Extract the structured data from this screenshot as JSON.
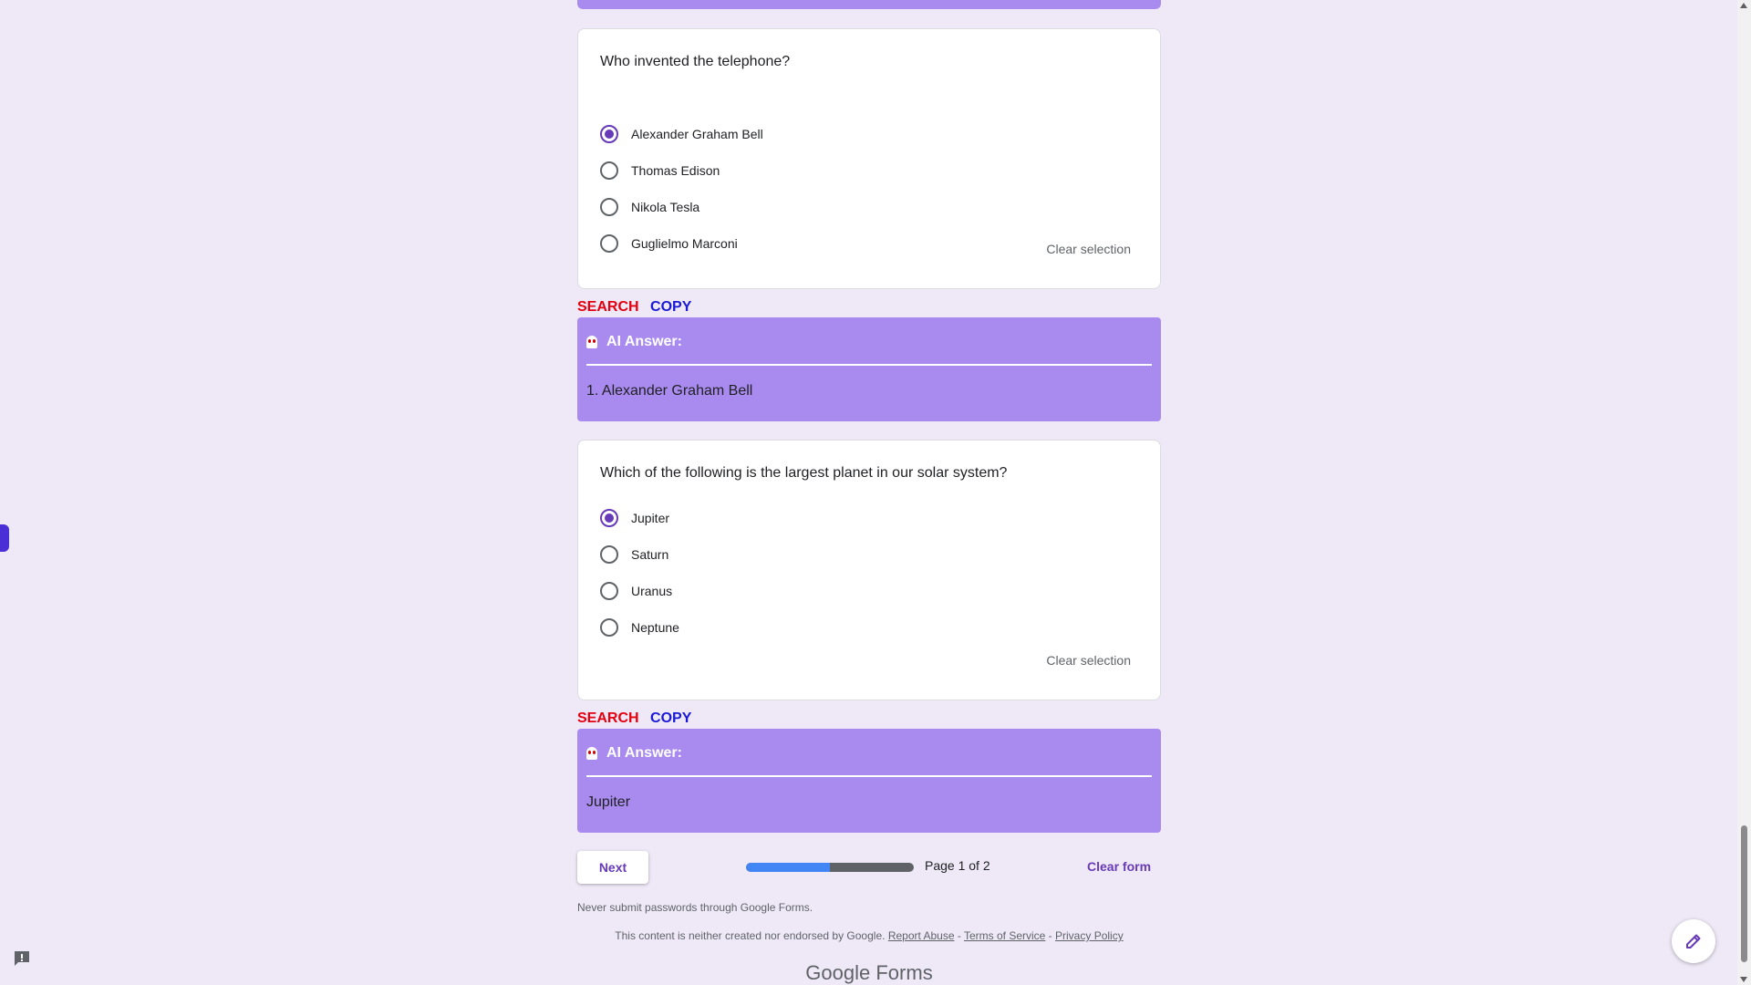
{
  "questions": [
    {
      "text": "Who invented the telephone?",
      "options": [
        "Alexander Graham Bell",
        "Thomas Edison",
        "Nikola Tesla",
        "Guglielmo Marconi"
      ],
      "selected_index": 0,
      "clear_label": "Clear selection"
    },
    {
      "text": "Which of the following is the largest planet in our solar system?",
      "options": [
        "Jupiter",
        "Saturn",
        "Uranus",
        "Neptune"
      ],
      "selected_index": 0,
      "clear_label": "Clear selection"
    }
  ],
  "actions": {
    "search_label": "SEARCH",
    "copy_label": "COPY"
  },
  "ai_answers": [
    {
      "heading": "AI Answer:",
      "answer": "1. Alexander Graham Bell"
    },
    {
      "heading": "AI Answer:",
      "answer": "Jupiter"
    }
  ],
  "footer_nav": {
    "next_label": "Next",
    "page_indicator": "Page 1 of 2",
    "progress_fraction": 0.5,
    "clear_form_label": "Clear form"
  },
  "footer": {
    "warning": "Never submit passwords through Google Forms.",
    "disclaimer": "This content is neither created nor endorsed by Google.",
    "report_abuse": "Report Abuse",
    "sep1": " - ",
    "terms": "Terms of Service",
    "sep2": " - ",
    "privacy": "Privacy Policy",
    "brand_google": "Google",
    "brand_forms": " Forms"
  },
  "colors": {
    "accent": "#673ab7",
    "ai_box": "#a98bef",
    "search": "#e3000f",
    "copy": "#1a1ad6",
    "progress": "#4285f4"
  },
  "icons": [
    "ghost-icon",
    "edit-pencil-icon",
    "feedback-icon"
  ]
}
